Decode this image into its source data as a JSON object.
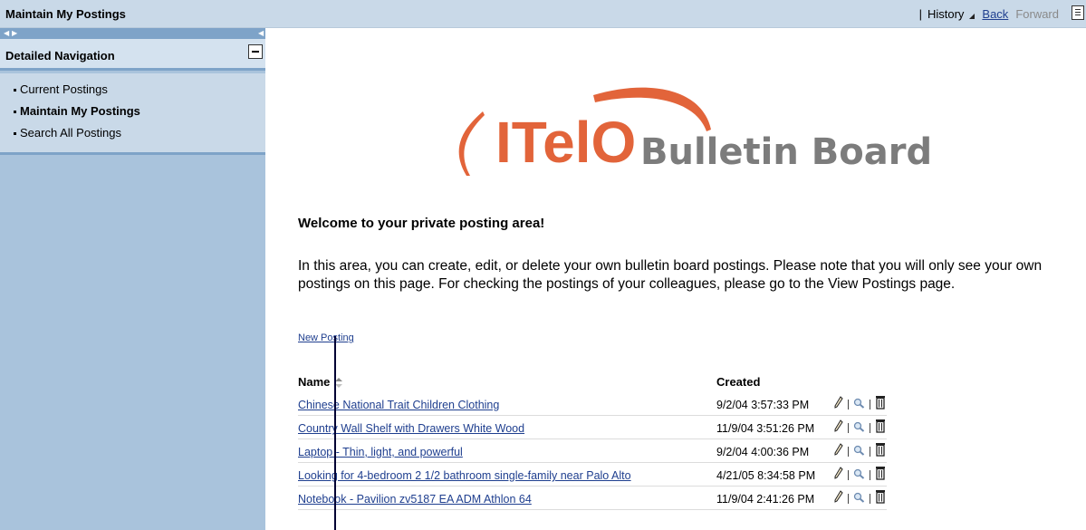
{
  "header": {
    "title": "Maintain My Postings",
    "separator": "|",
    "history_label": "History",
    "back_label": "Back",
    "forward_label": "Forward"
  },
  "nav": {
    "heading": "Detailed Navigation",
    "items": [
      {
        "label": "Current Postings",
        "active": false
      },
      {
        "label": "Maintain My Postings",
        "active": true
      },
      {
        "label": "Search All Postings",
        "active": false
      }
    ]
  },
  "logo": {
    "brand": "ITelO",
    "subtitle": "Bulletin Board",
    "brand_color": "#e2643a",
    "subtitle_color": "#7c7c7c"
  },
  "main": {
    "welcome": "Welcome to your private posting area!",
    "intro": "In this area, you can create, edit, or delete your own bulletin board postings. Please note that you will only see your own postings on this page. For checking the postings of your colleagues, please go to the View Postings page.",
    "new_posting": "New Posting"
  },
  "table": {
    "columns": [
      "Name",
      "Created"
    ],
    "rows": [
      {
        "name": "Chinese National Trait Children Clothing",
        "created": "9/2/04 3:57:33 PM"
      },
      {
        "name": "Country Wall Shelf with Drawers White Wood",
        "created": "11/9/04 3:51:26 PM"
      },
      {
        "name": "Laptop - Thin, light, and powerful",
        "created": "9/2/04 4:00:36 PM"
      },
      {
        "name": "Looking for 4-bedroom 2 1/2 bathroom single-family near Palo Alto",
        "created": "4/21/05 8:34:58 PM"
      },
      {
        "name": "Notebook -  Pavilion zv5187 EA ADM Athlon 64",
        "created": "11/9/04 2:41:26 PM"
      }
    ],
    "row_actions": [
      "edit-icon",
      "view-icon",
      "delete-icon"
    ]
  },
  "colors": {
    "title_bar": "#c9d9e8",
    "nav_background": "#a9c3dc",
    "link": "#1f3f8f"
  }
}
